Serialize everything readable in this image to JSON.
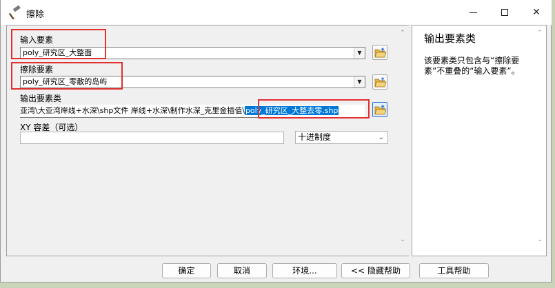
{
  "window": {
    "title": "擦除",
    "icon": "hammer-icon",
    "minimize_icon": "minimize-icon",
    "maximize_icon": "maximize-icon",
    "close_icon": "close-icon",
    "close_glyph": "✕"
  },
  "form": {
    "input_features": {
      "label": "输入要素",
      "value": "poly_研究区_大整面"
    },
    "erase_features": {
      "label": "擦除要素",
      "value": "poly_研究区_零散的岛屿"
    },
    "output_features": {
      "label": "输出要素类",
      "path_prefix": "亚湾\\大亚湾岸线+水深\\shp文件 岸线+水深\\制作水深_克里金插值\\",
      "selected_name": "poly_研究区_大整去零.shp"
    },
    "xy_tolerance": {
      "label": "XY 容差（可选）",
      "value": "",
      "unit": "十进制度"
    }
  },
  "help": {
    "title": "输出要素类",
    "text": "该要素类只包含与“擦除要素”不重叠的“输入要素”。"
  },
  "buttons": {
    "ok": "确定",
    "cancel": "取消",
    "environments": "环境...",
    "hide_help": "<< 隐藏帮助",
    "tool_help": "工具帮助"
  },
  "colors": {
    "highlight_box": "#e03030",
    "selection": "#0078d7"
  }
}
